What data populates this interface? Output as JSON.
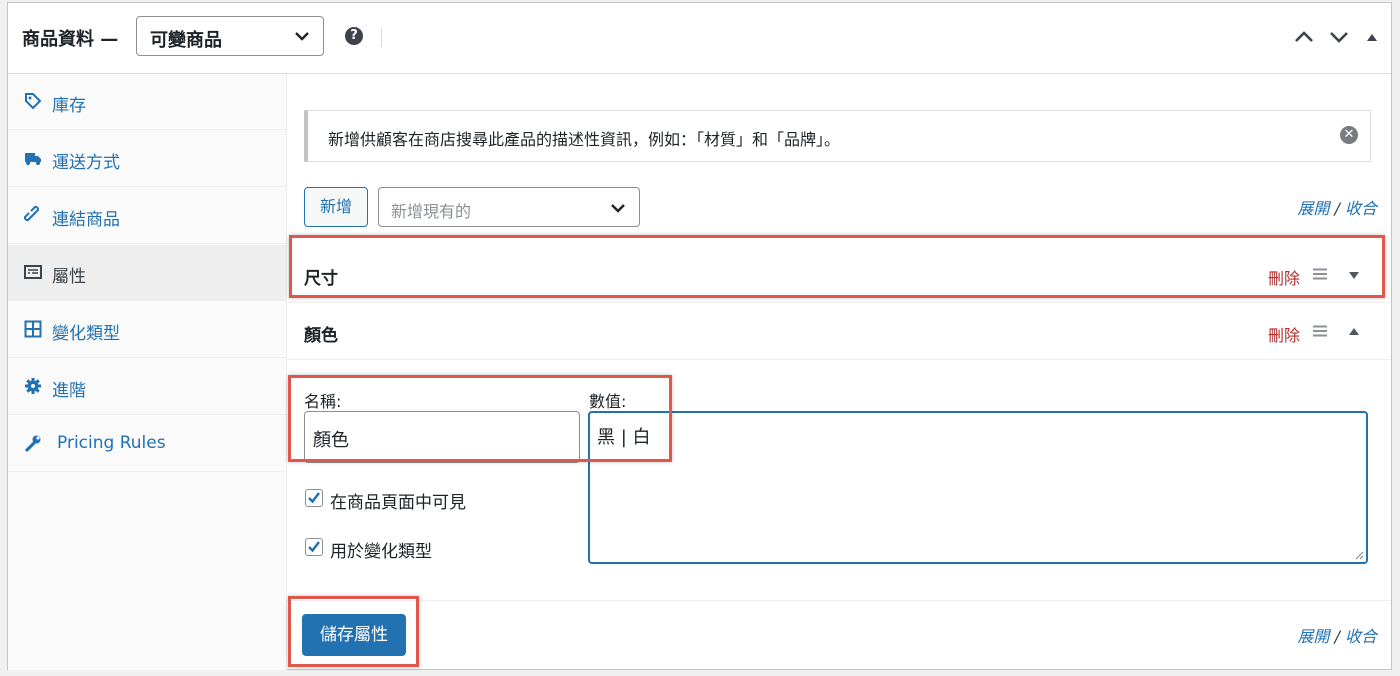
{
  "header": {
    "title": "商品資料 —",
    "product_type": "可變商品",
    "help_icon": "help-icon",
    "help_glyph": "?"
  },
  "sidebar": {
    "items": [
      {
        "label": "庫存",
        "icon": "tag-icon"
      },
      {
        "label": "運送方式",
        "icon": "truck-icon"
      },
      {
        "label": "連結商品",
        "icon": "link-icon"
      },
      {
        "label": "屬性",
        "icon": "list-icon",
        "active": true
      },
      {
        "label": "變化類型",
        "icon": "grid-icon"
      },
      {
        "label": "進階",
        "icon": "gear-icon"
      },
      {
        "label": "Pricing Rules",
        "icon": "wrench-icon"
      }
    ]
  },
  "main": {
    "notice": "新增供顧客在商店搜尋此產品的描述性資訊，例如：「材質」和「品牌」。",
    "add_button": "新增",
    "add_existing_placeholder": "新增現有的",
    "expand_label": "展開",
    "expand_separator": "/",
    "collapse_label": "收合",
    "attributes": [
      {
        "name": "尺寸",
        "remove_label": "刪除",
        "expanded": false
      },
      {
        "name": "顏色",
        "remove_label": "刪除",
        "expanded": true
      }
    ],
    "form": {
      "name_label": "名稱:",
      "name_value": "顏色",
      "values_label": "數值:",
      "values_value": "黑 | 白",
      "visible_label": "在商品頁面中可見",
      "visible_checked": true,
      "variation_label": "用於變化類型",
      "variation_checked": true
    },
    "save_button": "儲存屬性"
  },
  "colors": {
    "accent": "#2271b1",
    "danger": "#b32d2e",
    "highlight": "#e2574c"
  }
}
